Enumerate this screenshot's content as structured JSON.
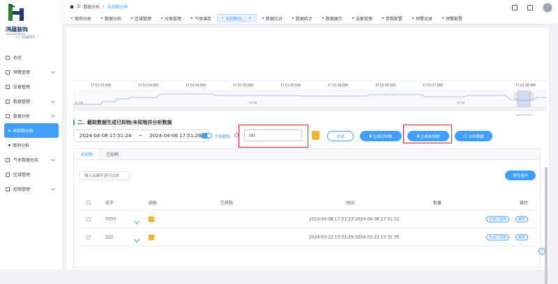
{
  "app": {
    "brand_cn": "鸿蕴装饰",
    "brand_en": "HONGJIAN DECOR",
    "user": "super"
  },
  "sidebar": {
    "items": [
      {
        "label": "总览"
      },
      {
        "label": "预警管理"
      },
      {
        "label": "设备管理"
      },
      {
        "label": "数据管理"
      },
      {
        "label": "数据分析"
      },
      {
        "label": "未知物分析"
      },
      {
        "label": "案例分析"
      },
      {
        "label": "气体数据仓库"
      },
      {
        "label": "区域管理"
      },
      {
        "label": "权限管理"
      }
    ]
  },
  "breadcrumb": {
    "parent": "数据分析",
    "current": "未知物分析"
  },
  "tabs": [
    "案例分析",
    "数据分析",
    "区域管理",
    "分类管理",
    "气体谱库",
    "未知物分...",
    "数据比对",
    "数据统计",
    "数据展示",
    "设备管理",
    "参数配置",
    "预警记录",
    "预警配置"
  ],
  "chart": {
    "ticks": [
      "17:51:23.500",
      "17:51:24.000",
      "17:51:24.500",
      "17:51:25.000",
      "17:51:25.500",
      "17:51:26.000",
      "17:51:26.500",
      "17:51:27.000",
      "17:51:28.000"
    ],
    "nav_labels": [
      "8. Apr",
      "17:00",
      "17:30"
    ],
    "credit": "Highcharts.com"
  },
  "section": {
    "title": "二、截取数据生成已知物/未知物并分析数据",
    "date_start": "2024-04-08 17:51:24",
    "date_sep": "~",
    "date_end": "2024-04-08 17:51:26",
    "switch_label": "开始截取",
    "input_value": "111",
    "btn_filter": "过滤",
    "btn_known": "生成已知物",
    "btn_unknown": "生成未知物",
    "btn_analyze": "分析数据"
  },
  "panel": {
    "tabs": [
      "未知物",
      "已知物"
    ],
    "filter_placeholder": "输入关键字进行过滤",
    "clear_btn": "清空选中",
    "columns": [
      "名字",
      "颜色",
      "已移除",
      "时间",
      "数量",
      "操作"
    ],
    "rows": [
      {
        "name": "5555",
        "time": "2024-04-08 17:51:23-2024-04-08 17:51:32",
        "action1": "生成已知物",
        "action2": "删除"
      },
      {
        "name": "222",
        "time": "2024-03-22 15:31:29-2024-03-22 15:31:35",
        "action1": "生成已知物",
        "action2": "删除"
      }
    ]
  },
  "colors": {
    "accent": "#409eff",
    "swatch": "#f5b430",
    "highlight": "#e02020"
  }
}
